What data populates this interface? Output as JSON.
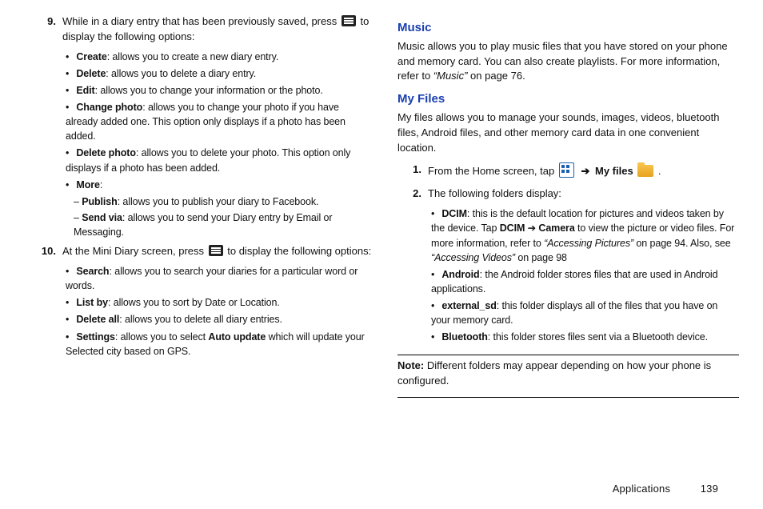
{
  "left": {
    "item9": {
      "num": "9.",
      "lead_a": "While in a diary entry that has been previously saved, press ",
      "lead_b": " to display the following options:",
      "bullets": [
        {
          "t": "Create",
          "d": ": allows you to create a new diary entry."
        },
        {
          "t": "Delete",
          "d": ": allows you to delete a diary entry."
        },
        {
          "t": "Edit",
          "d": ": allows you to change your information or the photo."
        },
        {
          "t": "Change photo",
          "d": ": allows you to change your photo if you have already added one. This option only displays if a photo has been added."
        },
        {
          "t": "Delete photo",
          "d": ": allows you to delete your photo. This option only displays if a photo has been added."
        },
        {
          "t": "More",
          "d": ":"
        }
      ],
      "more": [
        {
          "t": "Publish",
          "d": ": allows you to publish your diary to Facebook."
        },
        {
          "t": "Send via",
          "d": ": allows you to send your Diary entry by Email or Messaging."
        }
      ]
    },
    "item10": {
      "num": "10.",
      "lead_a": "At the Mini Diary screen, press ",
      "lead_b": " to display the following options:",
      "bullets": [
        {
          "t": "Search",
          "d": ": allows you to search your diaries for a particular word or words."
        },
        {
          "t": "List by",
          "d": ": allows you to sort by Date or Location."
        },
        {
          "t": "Delete all",
          "d": ": allows you to delete all diary entries."
        },
        {
          "t": "Settings",
          "d1": ": allows you to select ",
          "bold": "Auto update",
          "d2": " which will update your Selected city based on GPS."
        }
      ]
    }
  },
  "right": {
    "music_h": "Music",
    "music_p1": "Music allows you to play music files that you have stored on your phone and memory card. You can also create playlists. For more information, refer to ",
    "music_ref": "“Music”",
    "music_p2": "  on page 76.",
    "files_h": "My Files",
    "files_p": "My files allows you to manage your sounds, images, videos, bluetooth files, Android files, and other memory card data in one convenient location.",
    "step1": {
      "num": "1.",
      "a": "From the Home screen, tap ",
      "b": " ",
      "arrow": "➔",
      "c": " My files ",
      "d": " ."
    },
    "step2": {
      "num": "2.",
      "txt": "The following folders display:"
    },
    "folders": [
      {
        "t": "DCIM",
        "d1": ": this is the default location for pictures and videos taken by the device. Tap ",
        "b1": "DCIM",
        "arrow": " ➔ ",
        "b2": "Camera",
        "d2": " to view the picture or video files. For more information, refer to ",
        "i1": "“Accessing Pictures”",
        "d3": "  on page 94. Also, see ",
        "i2": "“Accessing Videos”",
        "d4": " on page 98"
      },
      {
        "t": "Android",
        "d": ": the Android folder stores files that are used in Android applications."
      },
      {
        "t": "external_sd",
        "d": ": this folder displays all of the files that you have on your memory card."
      },
      {
        "t": "Bluetooth",
        "d": ": this folder stores files sent via a Bluetooth device."
      }
    ],
    "note_l": "Note:",
    "note_t": " Different folders may appear depending on how your phone is configured."
  },
  "footer": {
    "section": "Applications",
    "page": "139"
  }
}
